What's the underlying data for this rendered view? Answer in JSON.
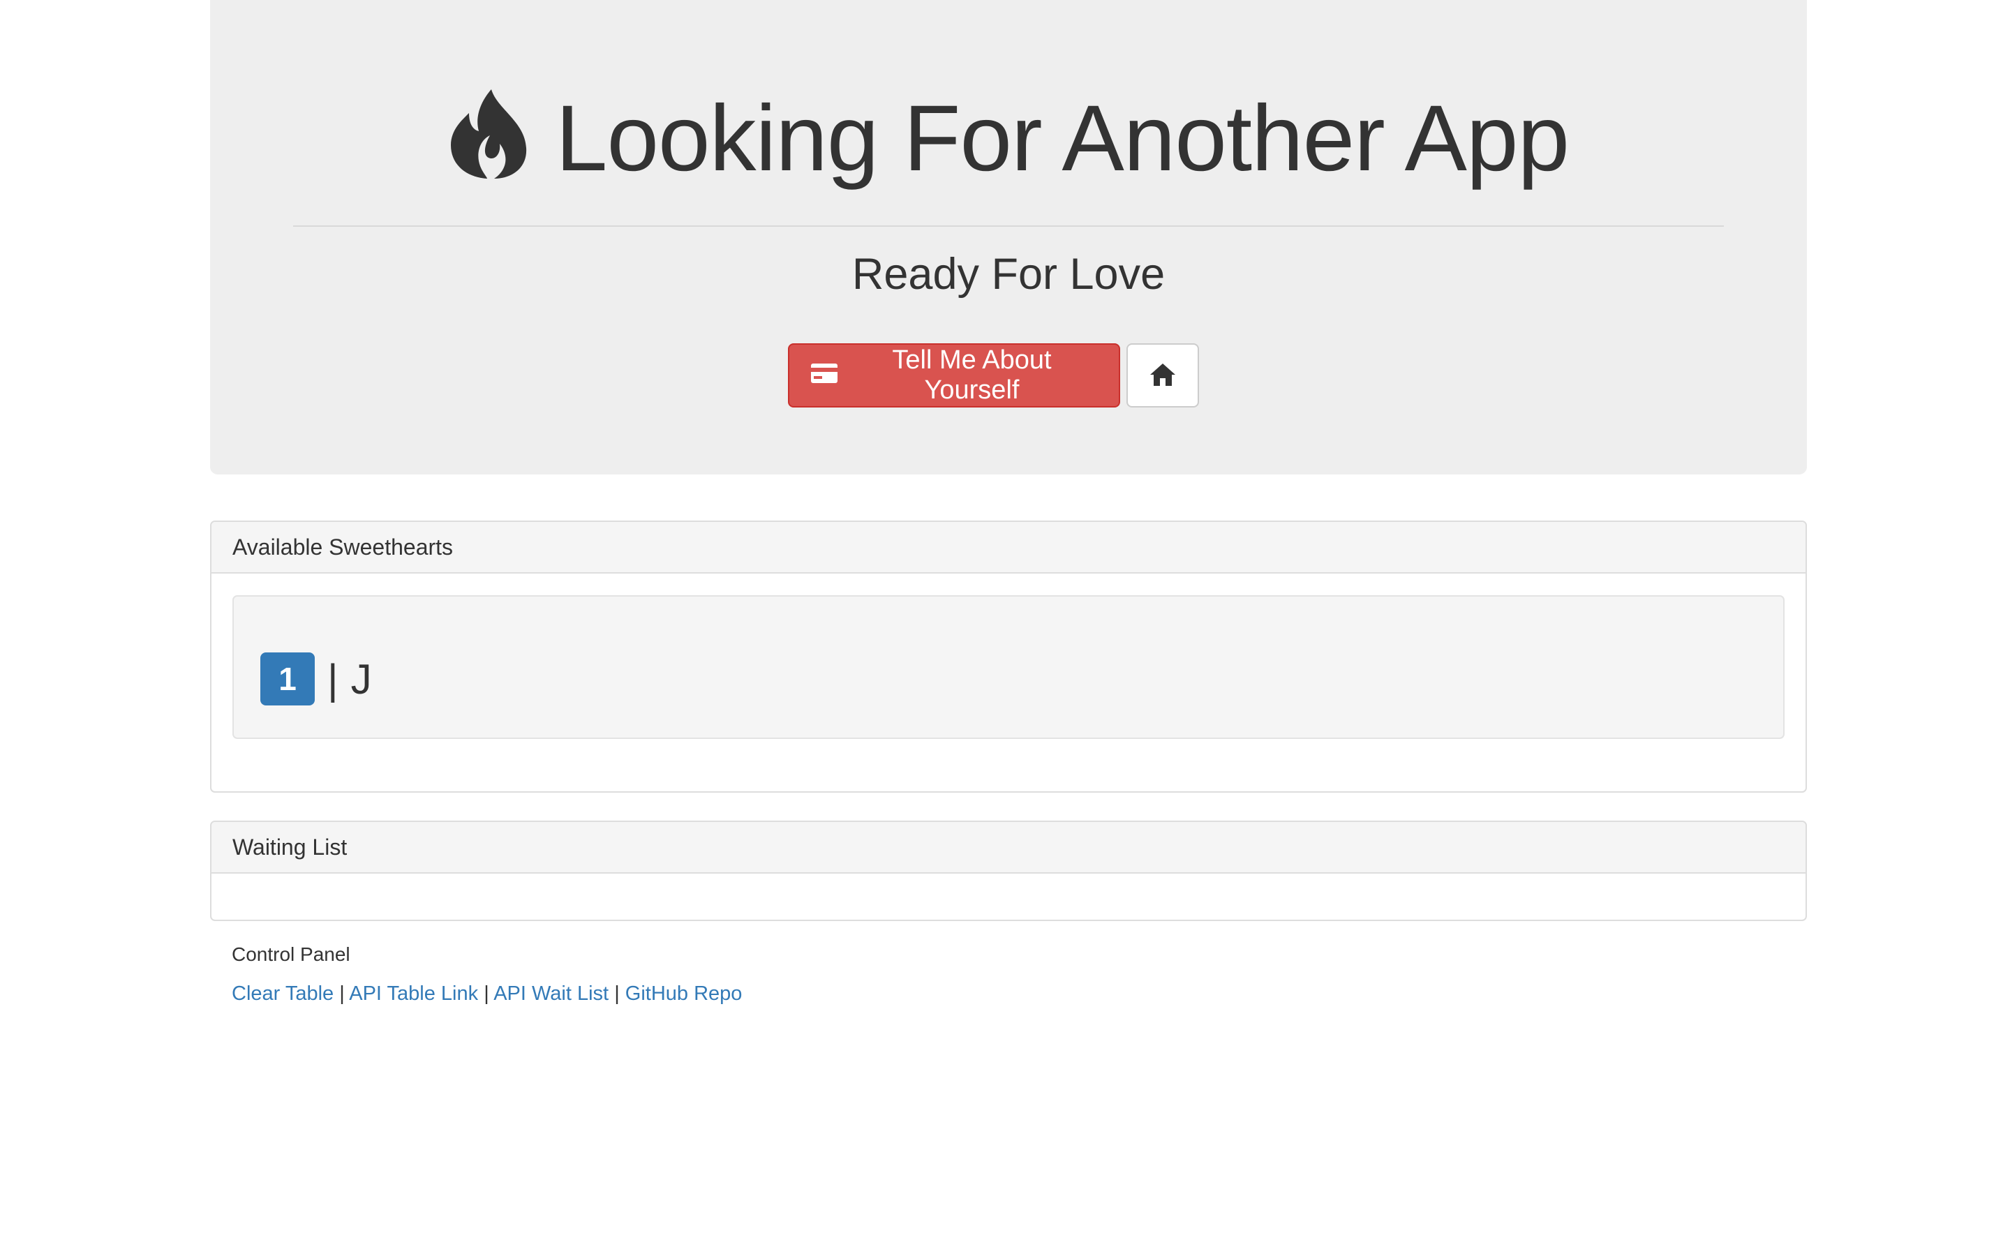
{
  "header": {
    "title": "Looking For Another App",
    "subtitle": "Ready For Love",
    "title_icon": "fire-icon",
    "primary_button_label": "Tell Me About Yourself",
    "primary_button_icon": "credit-card-icon",
    "home_button_icon": "home-icon"
  },
  "available_panel": {
    "heading": "Available Sweethearts",
    "entries": [
      {
        "number": "1",
        "separator": "|",
        "name": "J"
      }
    ]
  },
  "waiting_panel": {
    "heading": "Waiting List"
  },
  "control_panel": {
    "label": "Control Panel",
    "links": [
      "Clear Table",
      "API Table Link",
      "API Wait List",
      "GitHub Repo"
    ],
    "separator": "|"
  },
  "colors": {
    "danger": "#d9534f",
    "primary": "#337ab7",
    "jumbotron_bg": "#eeeeee",
    "link": "#337ab7"
  }
}
